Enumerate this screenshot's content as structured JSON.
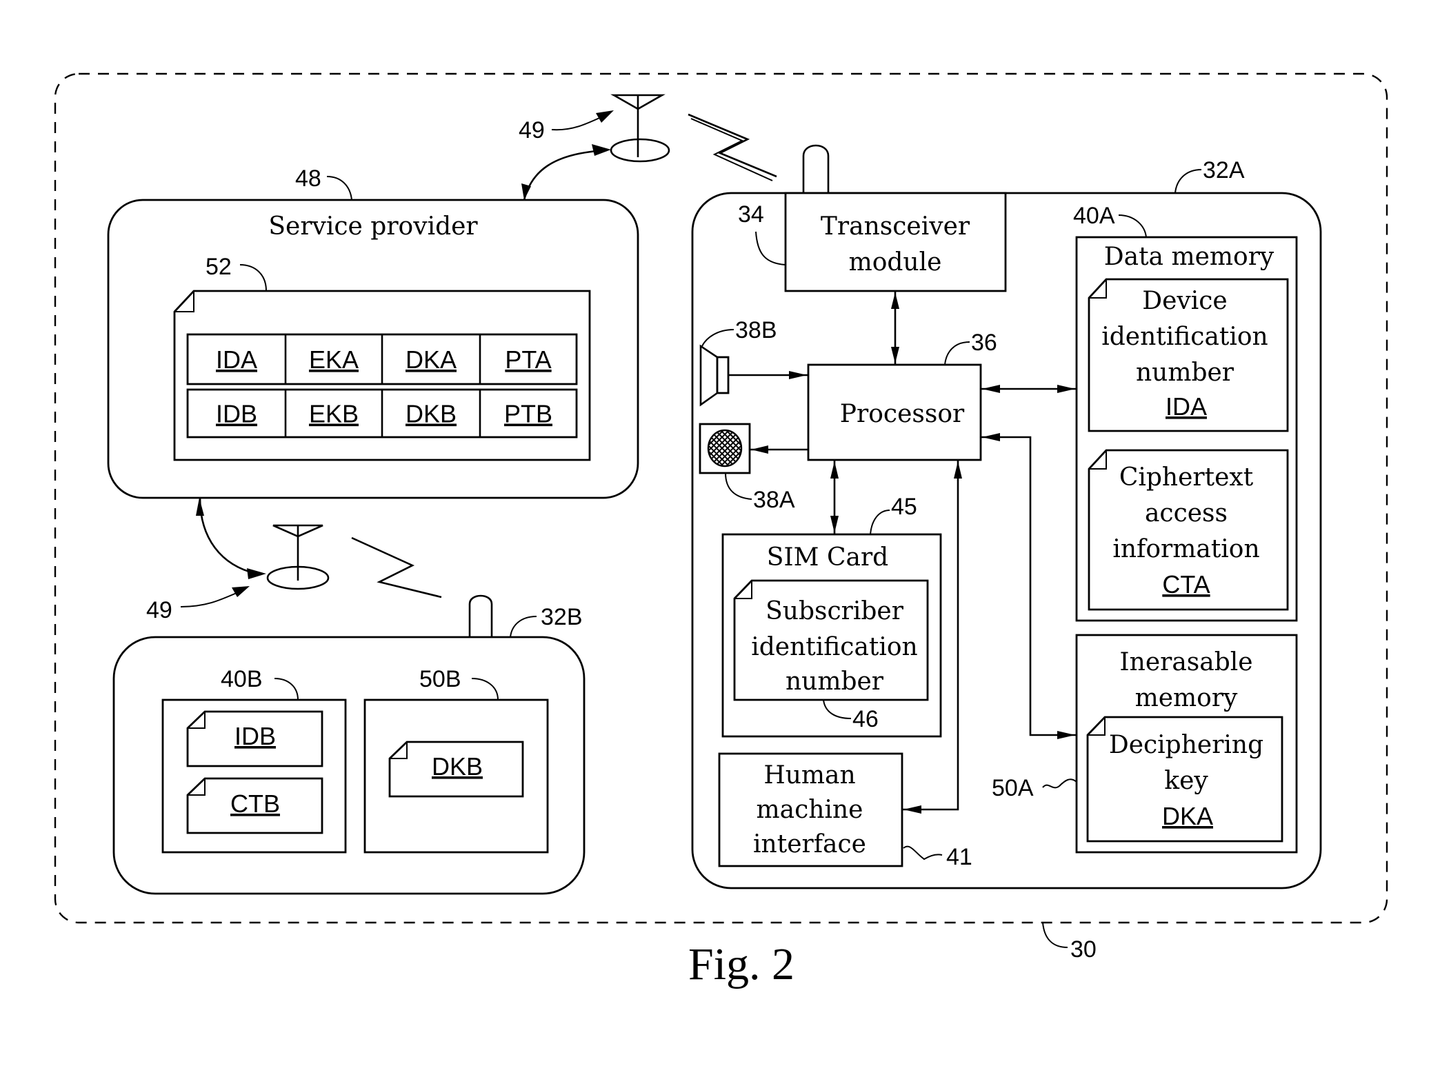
{
  "figure": {
    "caption": "Fig. 2",
    "system_ref": "30"
  },
  "service_provider": {
    "ref": "48",
    "title": "Service provider",
    "table_ref": "52",
    "table_rows": [
      [
        "IDA",
        "EKA",
        "DKA",
        "PTA"
      ],
      [
        "IDB",
        "EKB",
        "DKB",
        "PTB"
      ]
    ]
  },
  "network": {
    "ref_top": "49",
    "ref_bottom": "49"
  },
  "device_b": {
    "ref": "32B",
    "data_memory_ref": "40B",
    "data_items": [
      "IDB",
      "CTB"
    ],
    "inerasable_ref": "50B",
    "inerasable_items": [
      "DKB"
    ]
  },
  "device_a": {
    "ref": "32A",
    "transceiver": {
      "ref": "34",
      "lines": [
        "Transceiver",
        "module"
      ]
    },
    "processor": {
      "ref": "36",
      "label": "Processor"
    },
    "speaker_ref": "38B",
    "display_ref": "38A",
    "sim_card": {
      "ref": "45",
      "title": "SIM Card",
      "doc_ref": "46",
      "doc_lines": [
        "Subscriber",
        "identification",
        "number"
      ]
    },
    "hmi": {
      "ref": "41",
      "lines": [
        "Human",
        "machine",
        "interface"
      ]
    },
    "data_memory": {
      "ref": "40A",
      "title": "Data memory",
      "doc1_lines": [
        "Device",
        "identification",
        "number"
      ],
      "doc1_code": "IDA",
      "doc2_lines": [
        "Ciphertext",
        "access",
        "information"
      ],
      "doc2_code": "CTA"
    },
    "inerasable_memory": {
      "ref": "50A",
      "title_lines": [
        "Inerasable",
        "memory"
      ],
      "doc_lines": [
        "Deciphering",
        "key"
      ],
      "doc_code": "DKA"
    }
  }
}
